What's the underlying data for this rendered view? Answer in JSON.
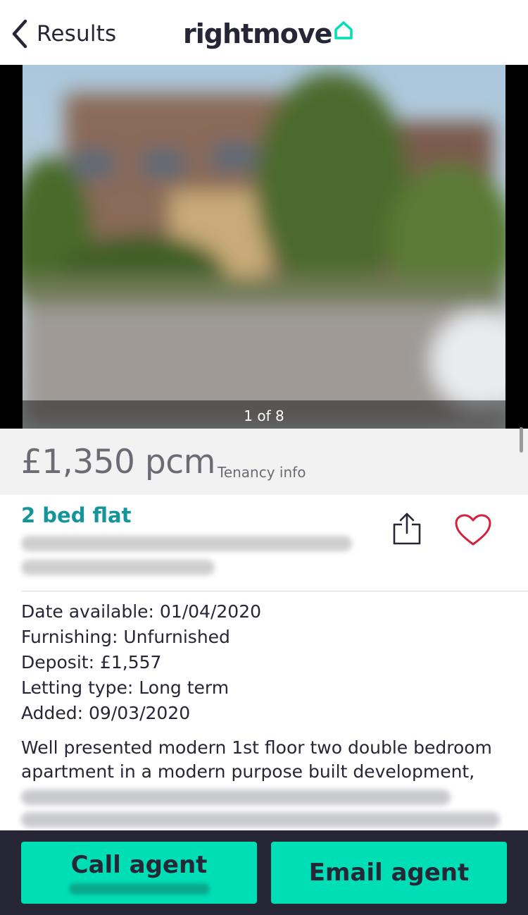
{
  "header": {
    "back_label": "Results",
    "logo_text": "rightmove"
  },
  "gallery": {
    "counter": "1 of 8"
  },
  "listing": {
    "price": "£1,350 pcm",
    "tenancy_link": "Tenancy info",
    "title": "2 bed flat",
    "facts": [
      "Date available: 01/04/2020",
      "Furnishing: Unfurnished",
      "Deposit: £1,557",
      "Letting type: Long term",
      "Added: 09/03/2020"
    ],
    "description": "Well presented modern 1st floor two double bedroom apartment in a modern purpose built development,"
  },
  "actions": {
    "call_label": "Call agent",
    "email_label": "Email agent"
  },
  "colors": {
    "brand_teal": "#00deb6",
    "title_teal": "#14949b",
    "dark": "#262637",
    "heart_red": "#d4213d"
  },
  "icons": {
    "back": "chevron-left-icon",
    "logo": "house-outline-icon",
    "share": "share-icon",
    "favourite": "heart-icon"
  }
}
